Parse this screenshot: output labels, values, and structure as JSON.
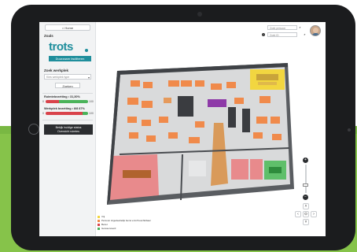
{
  "sidebar": {
    "home_label": "⌂ Home",
    "location_label": "Zoals",
    "logo_text": "trots",
    "logo_tagline": "Duurzaam faciliteren",
    "search_label": "Zoek werkplek",
    "select_placeholder": "Kies werkplek type",
    "search_button": "Zoeken",
    "stat1_label": "Ruimtebezetting • 31,30%",
    "stat2_label": "Werkplek bezetting • 8/8 87%",
    "stat1_min": "0",
    "stat1_max": "100",
    "stat2_min": "0",
    "stat2_max": "100",
    "stat1_value": 31,
    "stat2_value": 87,
    "footer_line1": "Bekijk huidige status",
    "footer_line2": "Overzicht ruimtes",
    "colors": {
      "red": "#d9434b",
      "green": "#4bb35a",
      "brand": "#1f8e9c"
    }
  },
  "header": {
    "search1_placeholder": "Zoek persoon",
    "search2_placeholder": "Zoek ID",
    "search_icon": "search-icon",
    "info_icon": "info-icon",
    "avatar": "avatar"
  },
  "legend": [
    {
      "label": "Vrij",
      "color": "#f2d640"
    },
    {
      "label": "Persoon is/gedeeltelijk bezet en/of beschikbaar",
      "color": "#f08a4b"
    },
    {
      "label": "Bezet",
      "color": "#d9434b"
    },
    {
      "label": "Gereserveerd",
      "color": "#4bb35a"
    }
  ],
  "zoom": {
    "plus": "+",
    "minus": "−"
  },
  "pan": {
    "left": "‹",
    "center": "⊙",
    "right": "›",
    "up": "˄",
    "down": "˅"
  }
}
